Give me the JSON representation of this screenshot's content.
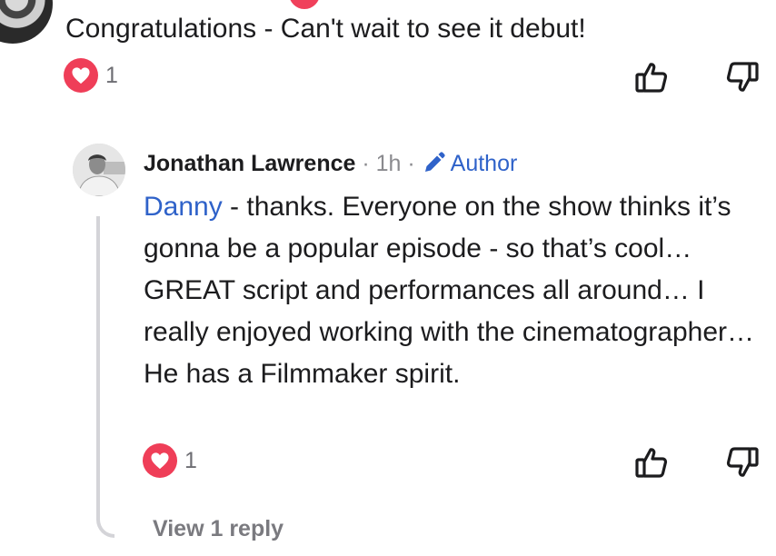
{
  "parent_comment": {
    "text": "Congratulations - Can't wait to see it debut!",
    "reaction_count": "1",
    "reaction_icon": "heart-icon",
    "like_icon": "thumbs-up-icon",
    "dislike_icon": "thumbs-down-icon"
  },
  "reply": {
    "author": "Jonathan Lawrence",
    "separator_1": " · ",
    "time": "1h",
    "separator_2": " · ",
    "badge_label": "Author",
    "badge_icon": "pencil-icon",
    "mention": "Danny",
    "body": " - thanks. Everyone on the show thinks it’s gonna be a popular episode - so that’s cool… GREAT script and performances all around… I really enjoyed working with the cinematographer… He has a Filmmaker spirit.",
    "reaction_count": "1",
    "reaction_icon": "heart-icon",
    "like_icon": "thumbs-up-icon",
    "dislike_icon": "thumbs-down-icon",
    "view_replies_label": "View 1 reply"
  },
  "colors": {
    "heart": "#ef3e58",
    "link": "#2f62c9",
    "muted": "#7a7a7f",
    "thread_line": "#d4d4d8"
  }
}
